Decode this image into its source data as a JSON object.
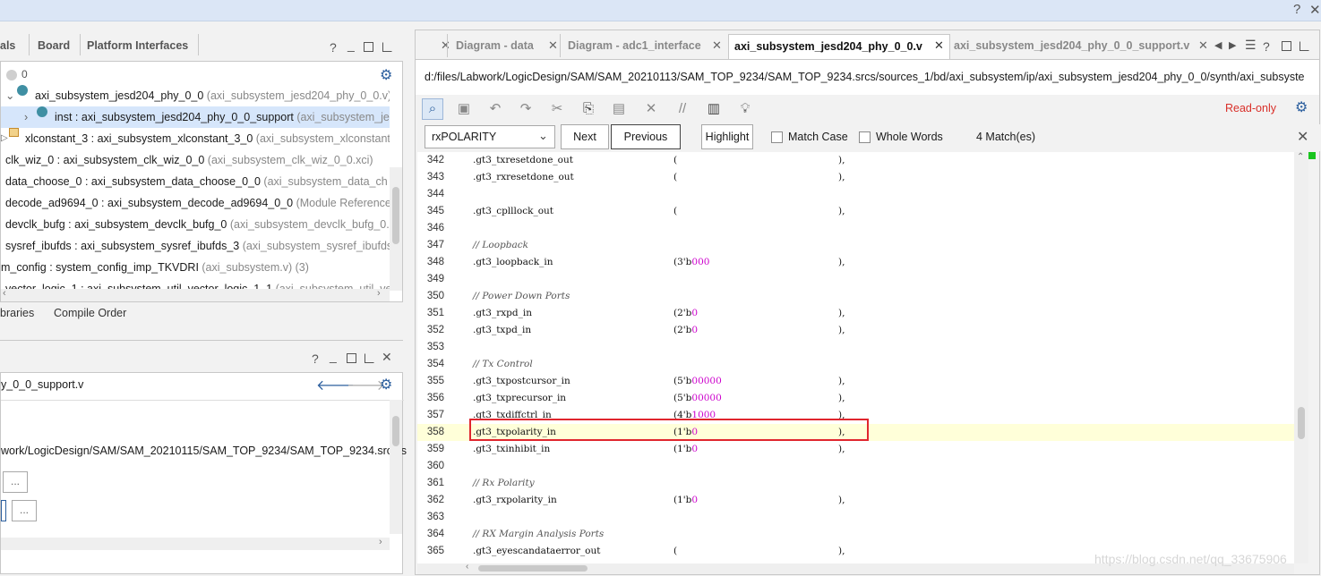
{
  "window": {
    "help": "?",
    "close": "✕"
  },
  "left_top": {
    "tabs": [
      "als",
      "Board",
      "Platform Interfaces"
    ],
    "status_count": "0",
    "tree": [
      {
        "text": "axi_subsystem_jesd204_phy_0_0",
        "suffix": " (axi_subsystem_jesd204_phy_0_0.v)"
      },
      {
        "text": "inst : axi_subsystem_jesd204_phy_0_0_support",
        "suffix": " (axi_subsystem_jes"
      },
      {
        "text": "xlconstant_3 : axi_subsystem_xlconstant_3_0",
        "suffix": " (axi_subsystem_xlconstant_"
      },
      {
        "text": "clk_wiz_0 : axi_subsystem_clk_wiz_0_0",
        "suffix": " (axi_subsystem_clk_wiz_0_0.xci)"
      },
      {
        "text": "data_choose_0 : axi_subsystem_data_choose_0_0",
        "suffix": " (axi_subsystem_data_ch"
      },
      {
        "text": "decode_ad9694_0 : axi_subsystem_decode_ad9694_0_0",
        "suffix": " (Module Reference"
      },
      {
        "text": "devclk_bufg : axi_subsystem_devclk_bufg_0",
        "suffix": " (axi_subsystem_devclk_bufg_0.x"
      },
      {
        "text": "sysref_ibufds : axi_subsystem_sysref_ibufds_3",
        "suffix": " (axi_subsystem_sysref_ibufds"
      },
      {
        "text": "m_config : system_config_imp_TKVDRI",
        "suffix": " (axi_subsystem.v) (3)"
      },
      {
        "text": "vector_logic_1 : axi_subsystem_util_vector_logic_1_1",
        "suffix": " (axi_subsystem_util_ve"
      }
    ],
    "bottom_tabs": [
      "braries",
      "Compile Order"
    ]
  },
  "left_bottom": {
    "filename": "y_0_0_support.v",
    "path": "work/LogicDesign/SAM/SAM_20210115/SAM_TOP_9234/SAM_TOP_9234.srcs/s",
    "ellipsis": "..."
  },
  "editor": {
    "tabs": [
      {
        "label": "Diagram - data",
        "active": false
      },
      {
        "label": "Diagram - adc1_interface",
        "active": false
      },
      {
        "label": "axi_subsystem_jesd204_phy_0_0.v",
        "active": true
      },
      {
        "label": "axi_subsystem_jesd204_phy_0_0_support.v",
        "active": false
      }
    ],
    "path": "d:/files/Labwork/LogicDesign/SAM/SAM_20210113/SAM_TOP_9234/SAM_TOP_9234.srcs/sources_1/bd/axi_subsystem/ip/axi_subsystem_jesd204_phy_0_0/synth/axi_subsyste",
    "read_only": "Read-only",
    "find": {
      "query": "rxPOLARITY",
      "next": "Next",
      "previous": "Previous",
      "highlight": "Highlight",
      "match_case": "Match Case",
      "whole_words": "Whole Words",
      "matches": "4 Match(es)"
    },
    "lines": [
      {
        "n": "342",
        "port": ".gt3_txresetdone_out",
        "open": "(",
        "lit": "",
        "close": "),"
      },
      {
        "n": "343",
        "port": ".gt3_rxresetdone_out",
        "open": "(",
        "lit": "",
        "close": "),"
      },
      {
        "n": "344"
      },
      {
        "n": "345",
        "port": ".gt3_cplllock_out",
        "open": "(",
        "lit": "",
        "close": "),"
      },
      {
        "n": "346"
      },
      {
        "n": "347",
        "comment": "// Loopback"
      },
      {
        "n": "348",
        "port": ".gt3_loopback_in",
        "open": "(3'b",
        "lit": "000",
        "close": "),"
      },
      {
        "n": "349"
      },
      {
        "n": "350",
        "comment": "// Power Down Ports"
      },
      {
        "n": "351",
        "port": ".gt3_rxpd_in",
        "open": "(2'b",
        "lit": "0",
        "close": "),"
      },
      {
        "n": "352",
        "port": ".gt3_txpd_in",
        "open": "(2'b",
        "lit": "0",
        "close": "),"
      },
      {
        "n": "353"
      },
      {
        "n": "354",
        "comment": "// Tx Control"
      },
      {
        "n": "355",
        "port": ".gt3_txpostcursor_in",
        "open": "(5'b",
        "lit": "00000",
        "close": "),"
      },
      {
        "n": "356",
        "port": ".gt3_txprecursor_in",
        "open": "(5'b",
        "lit": "00000",
        "close": "),"
      },
      {
        "n": "357",
        "port": ".gt3_txdiffctrl_in",
        "open": "(4'b",
        "lit": "1000",
        "close": "),"
      },
      {
        "n": "358",
        "port": ".gt3_txpolarity_in",
        "open": "(1'b",
        "lit": "0",
        "close": "),",
        "highlight": true
      },
      {
        "n": "359",
        "port": ".gt3_txinhibit_in",
        "open": "(1'b",
        "lit": "0",
        "close": "),"
      },
      {
        "n": "360"
      },
      {
        "n": "361",
        "comment": "// Rx Polarity"
      },
      {
        "n": "362",
        "port": ".gt3_rxpolarity_in",
        "open": "(1'b",
        "lit": "0",
        "close": "),"
      },
      {
        "n": "363"
      },
      {
        "n": "364",
        "comment": "// RX Margin Analysis Ports"
      },
      {
        "n": "365",
        "port": ".gt3_eyescandataerror_out",
        "open": "(",
        "lit": "",
        "close": "),"
      }
    ]
  },
  "watermark": "https://blog.csdn.net/qq_33675906",
  "colors": {
    "accent": "#3f8fa3",
    "selected_row": "#d6e6fb",
    "highlight_box": "#e0262e",
    "read_only": "#d9302a"
  }
}
